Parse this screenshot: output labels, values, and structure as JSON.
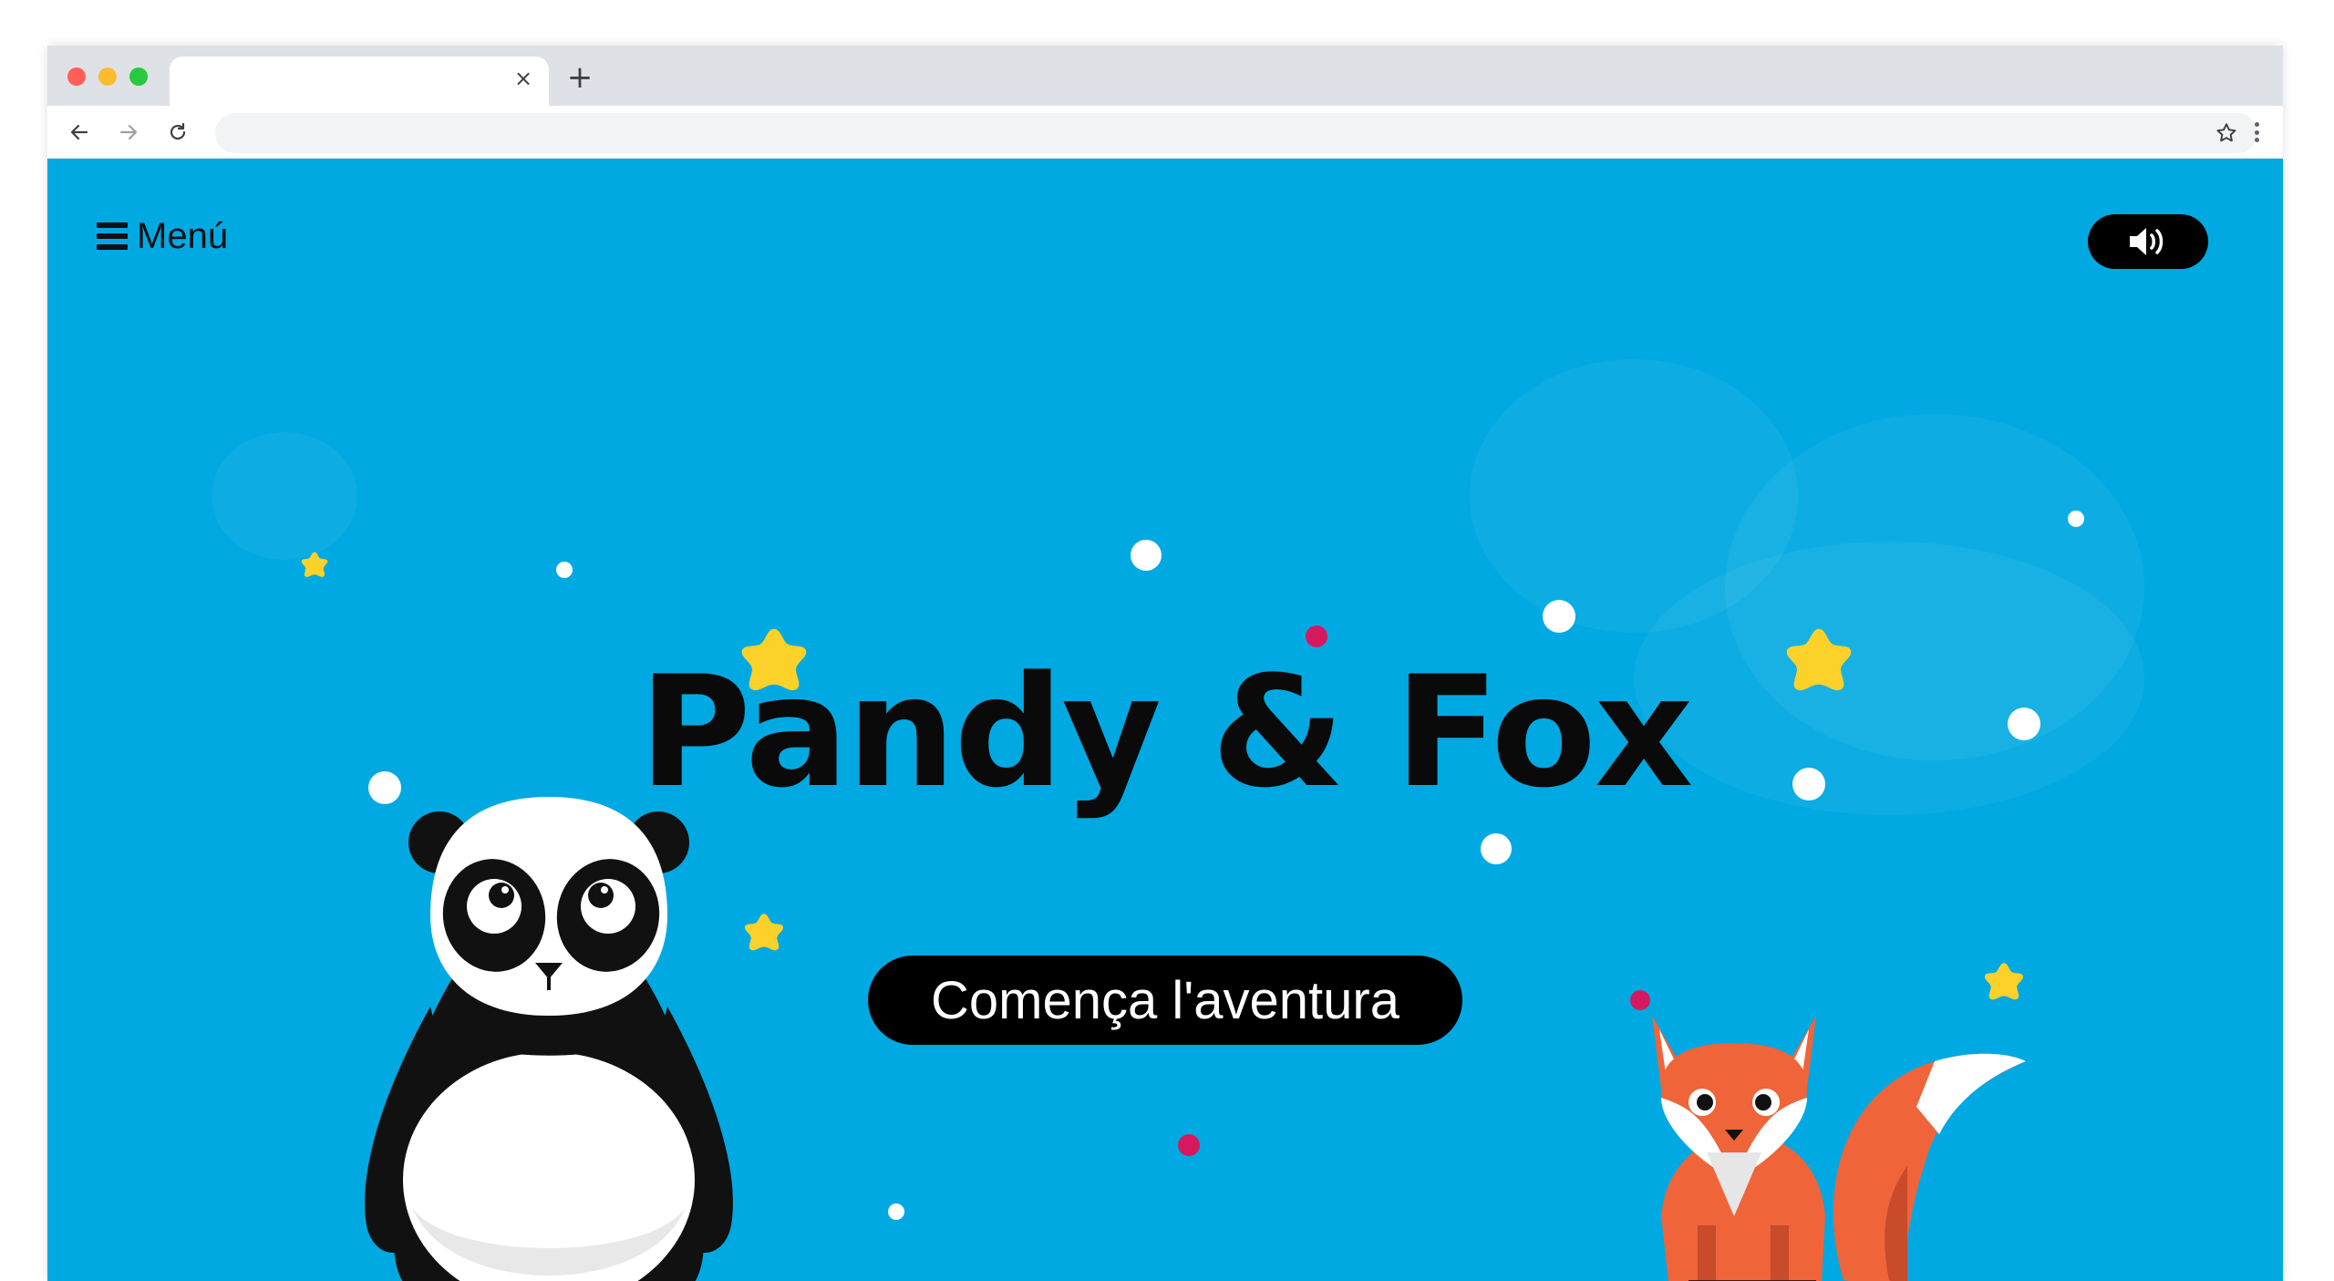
{
  "browser": {
    "tab_title": "",
    "tab_close_icon": "close-icon",
    "new_tab_icon": "plus-icon",
    "url": "",
    "nav_icons": [
      "arrow-left-icon",
      "arrow-right-icon",
      "reload-icon"
    ],
    "toolbar_icons": [
      "star-icon",
      "kebab-menu-icon"
    ]
  },
  "page": {
    "background_color": "#00a9e2",
    "menu": {
      "label": "Menú",
      "icon": "hamburger-icon"
    },
    "sound_button": {
      "icon": "speaker-icon"
    },
    "title": "Pandy & Fox",
    "cta_label": "Comença l'aventura",
    "characters": [
      "panda",
      "fox"
    ],
    "decorations": {
      "star_color": "#fcd12a",
      "accent_dot_color": "#d6195f"
    }
  }
}
